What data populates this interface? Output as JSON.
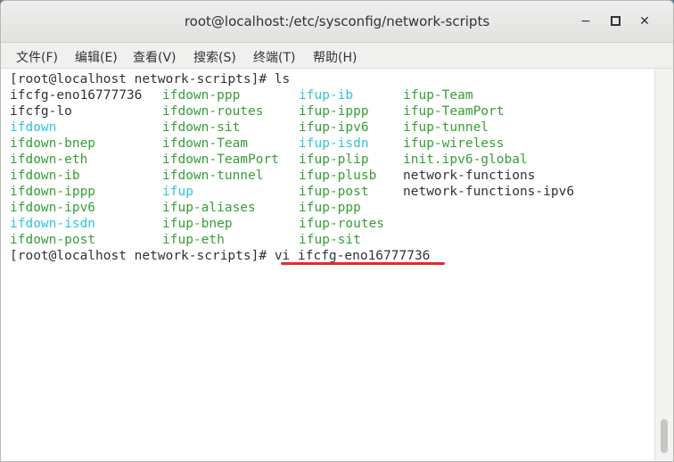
{
  "window": {
    "title": "root@localhost:/etc/sysconfig/network-scripts",
    "minimize_glyph": "−",
    "close_glyph": "✕"
  },
  "menu": [
    "文件(F)",
    "编辑(E)",
    "查看(V)",
    "搜索(S)",
    "终端(T)",
    "帮助(H)"
  ],
  "colors": {
    "green": "#36a036",
    "cyan": "#31c5d8",
    "underline": "#e02c2c"
  },
  "terminal": {
    "prompt1": "[root@localhost network-scripts]# ls",
    "rows": [
      [
        [
          "ifcfg-eno16777736",
          "plain"
        ],
        [
          "ifdown-ppp",
          "green"
        ],
        [
          "ifup-ib",
          "cyan"
        ],
        [
          "ifup-Team",
          "green"
        ]
      ],
      [
        [
          "ifcfg-lo",
          "plain"
        ],
        [
          "ifdown-routes",
          "green"
        ],
        [
          "ifup-ippp",
          "green"
        ],
        [
          "ifup-TeamPort",
          "green"
        ]
      ],
      [
        [
          "ifdown",
          "cyan"
        ],
        [
          "ifdown-sit",
          "green"
        ],
        [
          "ifup-ipv6",
          "green"
        ],
        [
          "ifup-tunnel",
          "green"
        ]
      ],
      [
        [
          "ifdown-bnep",
          "green"
        ],
        [
          "ifdown-Team",
          "green"
        ],
        [
          "ifup-isdn",
          "cyan"
        ],
        [
          "ifup-wireless",
          "green"
        ]
      ],
      [
        [
          "ifdown-eth",
          "green"
        ],
        [
          "ifdown-TeamPort",
          "green"
        ],
        [
          "ifup-plip",
          "green"
        ],
        [
          "init.ipv6-global",
          "green"
        ]
      ],
      [
        [
          "ifdown-ib",
          "green"
        ],
        [
          "ifdown-tunnel",
          "green"
        ],
        [
          "ifup-plusb",
          "green"
        ],
        [
          "network-functions",
          "plain"
        ]
      ],
      [
        [
          "ifdown-ippp",
          "green"
        ],
        [
          "ifup",
          "cyan"
        ],
        [
          "ifup-post",
          "green"
        ],
        [
          "network-functions-ipv6",
          "plain"
        ]
      ],
      [
        [
          "ifdown-ipv6",
          "green"
        ],
        [
          "ifup-aliases",
          "green"
        ],
        [
          "ifup-ppp",
          "green"
        ],
        [
          "",
          ""
        ]
      ],
      [
        [
          "ifdown-isdn",
          "cyan"
        ],
        [
          "ifup-bnep",
          "green"
        ],
        [
          "ifup-routes",
          "green"
        ],
        [
          "",
          ""
        ]
      ],
      [
        [
          "ifdown-post",
          "green"
        ],
        [
          "ifup-eth",
          "green"
        ],
        [
          "ifup-sit",
          "green"
        ],
        [
          "",
          ""
        ]
      ]
    ],
    "prompt2": "[root@localhost network-scripts]# ",
    "command": "vi ifcfg-eno16777736"
  }
}
